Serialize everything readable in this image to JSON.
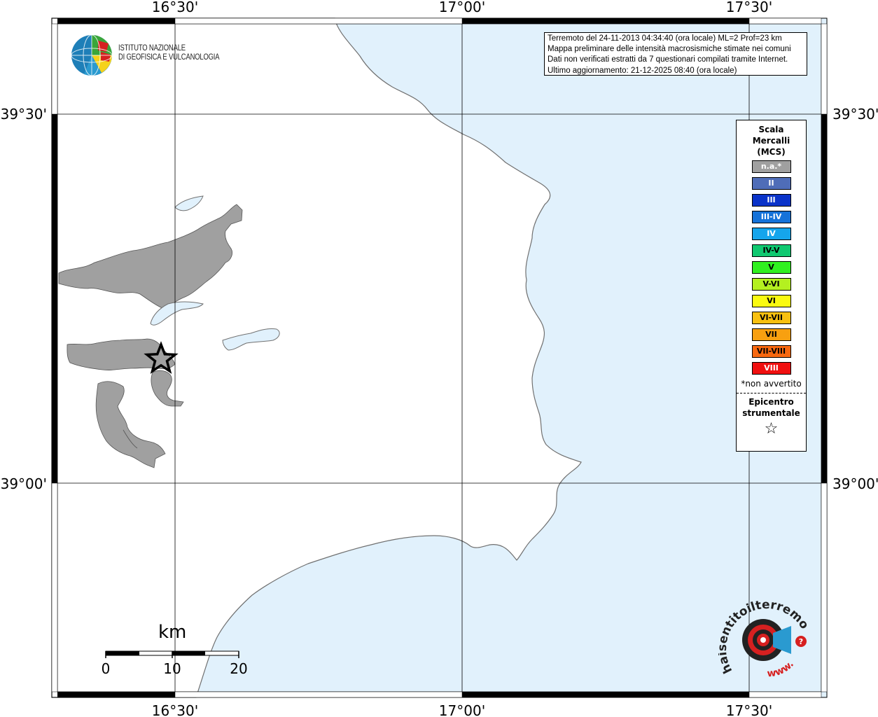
{
  "map": {
    "title_lines": [
      "Terremoto del 24-11-2013 04:34:40 (ora locale) ML=2 Prof=23 km",
      "Mappa preliminare delle intensità macrosismiche stimate nei comuni",
      "Dati non verificati estratti da 7 questionari compilati tramite Internet.",
      "Ultimo aggiornamento: 21-12-2025 08:40 (ora locale)"
    ],
    "lon_labels": [
      "16°30'",
      "17°00'",
      "17°30'"
    ],
    "lat_labels": [
      "39°30'",
      "39°00'"
    ],
    "colors": {
      "sea": "#e1f1fc",
      "land": "#ffffff",
      "municipality": "#a0a0a0",
      "coast": "#707070"
    }
  },
  "ingv": {
    "line1": "ISTITUTO NAZIONALE",
    "line2": "DI GEOFISICA E VULCANOLOGIA"
  },
  "legend": {
    "title_lines": [
      "Scala",
      "Mercalli",
      "(MCS)"
    ],
    "items": [
      {
        "label": "n.a.*",
        "color": "#a0a0a0",
        "dark": false
      },
      {
        "label": "II",
        "color": "#4f6db8",
        "dark": false
      },
      {
        "label": "III",
        "color": "#0a33c9",
        "dark": false
      },
      {
        "label": "III-IV",
        "color": "#1572d9",
        "dark": false
      },
      {
        "label": "IV",
        "color": "#15a5ec",
        "dark": false
      },
      {
        "label": "IV-V",
        "color": "#10c870",
        "dark": true
      },
      {
        "label": "V",
        "color": "#30f020",
        "dark": true
      },
      {
        "label": "V-VI",
        "color": "#b4f020",
        "dark": true
      },
      {
        "label": "VI",
        "color": "#fafa10",
        "dark": true
      },
      {
        "label": "VI-VII",
        "color": "#f8c010",
        "dark": true
      },
      {
        "label": "VII",
        "color": "#f8a010",
        "dark": true
      },
      {
        "label": "VII-VIII",
        "color": "#f86810",
        "dark": true
      },
      {
        "label": "VIII",
        "color": "#f01010",
        "dark": false
      }
    ],
    "note": "*non avvertito",
    "epicenter_lines": [
      "Epicentro",
      "strumentale"
    ],
    "epicenter_symbol": "☆"
  },
  "scalebar": {
    "unit": "km",
    "ticks": [
      "0",
      "10",
      "20"
    ]
  },
  "hst": {
    "text": "haisentitoilterremoto.it",
    "www": "www."
  }
}
